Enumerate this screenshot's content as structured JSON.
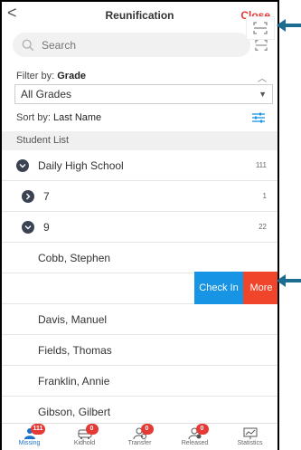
{
  "header": {
    "back_glyph": "<",
    "title": "Reunification",
    "close_label": "Close"
  },
  "search": {
    "placeholder": "Search"
  },
  "filter": {
    "label_prefix": "Filter by: ",
    "label_value": "Grade",
    "selected": "All Grades"
  },
  "sort": {
    "label_prefix": "Sort by: ",
    "label_value": "Last Name"
  },
  "list": {
    "header": "Student List",
    "school": {
      "name": "Daily High School",
      "count": "111"
    },
    "grades": [
      {
        "name": "7",
        "count": "1"
      },
      {
        "name": "9",
        "count": "22"
      }
    ],
    "students": [
      "Cobb, Stephen",
      "Davis, Manuel",
      "Fields, Thomas",
      "Franklin, Annie",
      "Gibson, Gilbert"
    ]
  },
  "row_actions": {
    "check_in": "Check In",
    "more": "More"
  },
  "tabs": [
    {
      "label": "Missing",
      "badge": "111",
      "icon": "person-icon"
    },
    {
      "label": "Kidhold",
      "badge": "0",
      "icon": "bus-icon"
    },
    {
      "label": "Transfer",
      "badge": "0",
      "icon": "person-transfer-icon"
    },
    {
      "label": "Released",
      "badge": "0",
      "icon": "person-check-icon"
    },
    {
      "label": "Statistics",
      "badge": "",
      "icon": "chart-icon"
    }
  ],
  "colors": {
    "accent_blue": "#1794e3",
    "danger_red": "#f0452b",
    "annotation_arrow": "#1d6d91"
  }
}
